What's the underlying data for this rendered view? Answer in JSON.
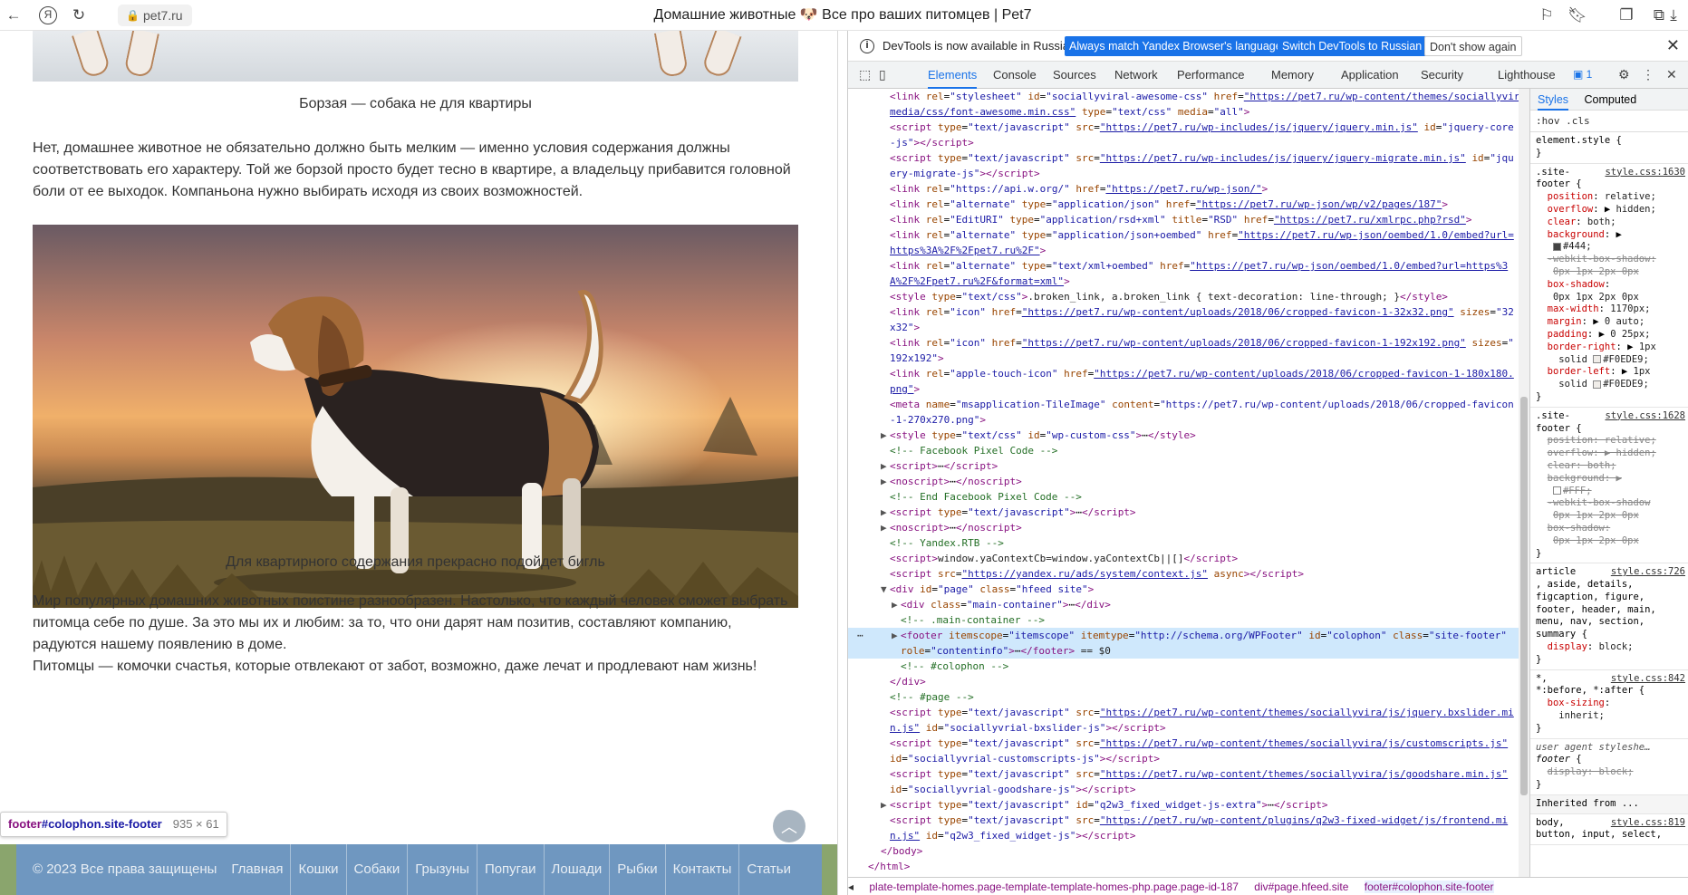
{
  "browser": {
    "url": "pet7.ru",
    "title": "Домашние животные 🐶 Все про ваших питомцев | Pet7"
  },
  "article": {
    "caption1": "Борзая — собака не для квартиры",
    "para1": "Нет, домашнее животное не обязательно должно быть мелким — именно условия содержания должны соответствовать его характеру. Той же борзой просто будет тесно в квартире, а владельцу прибавится головной боли от ее выходок. Компаньона нужно выбирать исходя из своих возможностей.",
    "caption2": "Для квартирного содержания прекрасно подойдет бигль",
    "para2": "Мир популярных домашних животных поистине разнообразен. Настолько, что каждый человек сможет выбрать питомца себе по душе. За это мы их и любим: за то, что они дарят нам позитив, составляют компанию, радуются нашему появлению в доме.",
    "para3": "Питомцы — комочки счастья, которые отвлекают от забот, возможно, даже лечат и продлевают нам жизнь!"
  },
  "tooltip": {
    "tag": "footer",
    "selector": "#colophon.site-footer",
    "dims": "935 × 61"
  },
  "footer": {
    "copyright": "© 2023 Все права защищены",
    "nav": [
      "Главная",
      "Кошки",
      "Собаки",
      "Грызуны",
      "Попугаи",
      "Лошади",
      "Рыбки",
      "Контакты",
      "Статьи"
    ]
  },
  "devtools": {
    "infobar": {
      "text": "DevTools is now available in Russian!",
      "btn1": "Always match Yandex Browser's language",
      "btn2": "Switch DevTools to Russian",
      "btn3": "Don't show again"
    },
    "tabs": [
      "Elements",
      "Console",
      "Sources",
      "Network",
      "Performance",
      "Memory",
      "Application",
      "Security",
      "Lighthouse"
    ],
    "issues_badge": "1",
    "styles_tabs": [
      "Styles",
      "Computed"
    ],
    "filter": ":hov .cls",
    "breadcrumbs": [
      "plate-template-homes.page-template-template-homes-php.page.page-id-187",
      "div#page.hfeed.site",
      "footer#colophon.site-footer"
    ],
    "inherited": "Inherited from ..."
  }
}
